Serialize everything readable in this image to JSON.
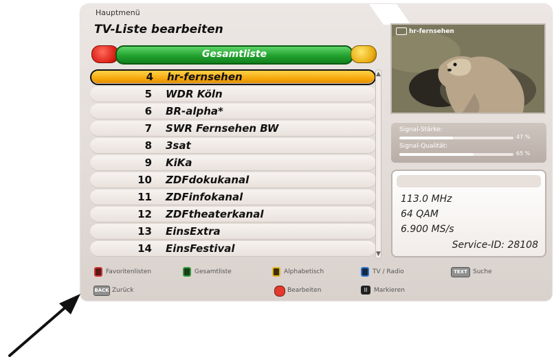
{
  "breadcrumb": "Hauptmenü",
  "title": "TV-Liste bearbeiten",
  "list_header": "Gesamtliste",
  "channels": [
    {
      "num": "4",
      "name": "hr-fernsehen",
      "selected": true
    },
    {
      "num": "5",
      "name": "WDR Köln"
    },
    {
      "num": "6",
      "name": "BR-alpha*"
    },
    {
      "num": "7",
      "name": "SWR Fernsehen BW"
    },
    {
      "num": "8",
      "name": "3sat"
    },
    {
      "num": "9",
      "name": "KiKa"
    },
    {
      "num": "10",
      "name": "ZDFdokukanal"
    },
    {
      "num": "11",
      "name": "ZDFinfokanal"
    },
    {
      "num": "12",
      "name": "ZDFtheaterkanal"
    },
    {
      "num": "13",
      "name": "EinsExtra"
    },
    {
      "num": "14",
      "name": "EinsFestival"
    }
  ],
  "preview": {
    "channel": "hr-fernsehen"
  },
  "signal": {
    "strength_label": "Signal-Stärke:",
    "strength_value": "47 %",
    "strength_fraction": 0.47,
    "quality_label": "Signal-Qualität:",
    "quality_value": "65 %",
    "quality_fraction": 0.65
  },
  "info": {
    "frequency": "113.0 MHz",
    "modulation": "64 QAM",
    "symbol_rate": "6.900 MS/s",
    "service_id": "Service-ID: 28108"
  },
  "footer": {
    "favorites": "Favoritenlisten",
    "all_list": "Gesamtliste",
    "alphabetical": "Alphabetisch",
    "tv_radio": "TV / Radio",
    "text_key": "TEXT",
    "search": "Suche",
    "back_key": "BACK",
    "back": "Zurück",
    "edit": "Bearbeiten",
    "mark_key": "II",
    "mark": "Markieren"
  },
  "colors": {
    "selected_row": "#f6a80c",
    "header_green": "#22a22f",
    "key_red": "#d81b12",
    "key_yellow": "#e8a90e",
    "key_blue": "#2f72c8"
  }
}
